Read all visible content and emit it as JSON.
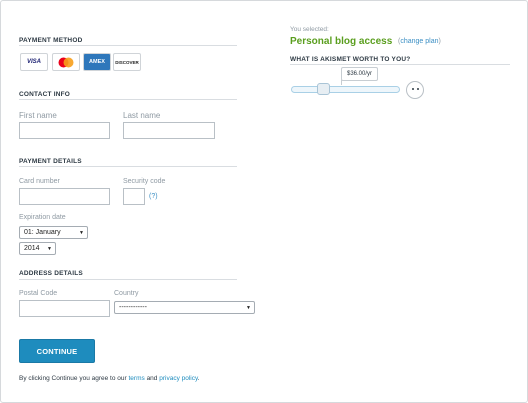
{
  "payment_method": {
    "title": "PAYMENT METHOD",
    "cards": [
      {
        "name": "visa-icon",
        "label": "VISA",
        "color": "#1a1f71"
      },
      {
        "name": "mastercard-icon",
        "label": "",
        "color": "#eb001b"
      },
      {
        "name": "amex-icon",
        "label": "AMEX",
        "color": "#2e77bb"
      },
      {
        "name": "discover-icon",
        "label": "DISCOVER",
        "color": "#222222"
      }
    ]
  },
  "contact_info": {
    "title": "CONTACT INFO",
    "first_name_placeholder": "First name",
    "last_name_placeholder": "Last name"
  },
  "payment_details": {
    "title": "PAYMENT DETAILS",
    "card_number_label": "Card number",
    "security_code_label": "Security code",
    "security_help": "(?)",
    "expiration_label": "Expiration date",
    "month_value": "01: January",
    "year_value": "2014"
  },
  "address_details": {
    "title": "ADDRESS DETAILS",
    "postal_code_label": "Postal Code",
    "country_label": "Country",
    "country_value": "------------"
  },
  "actions": {
    "continue_label": "CONTINUE",
    "terms_prefix": "By clicking Continue you agree to our",
    "terms_link": "terms",
    "and_text": "and",
    "privacy_link": "privacy policy",
    "period": "."
  },
  "plan": {
    "selected_label": "You selected:",
    "name": "Personal blog access",
    "change_open": "(",
    "change_link": "change plan",
    "change_close": ")",
    "worth_title": "WHAT IS AKISMET WORTH TO YOU?",
    "price": "$36.00/yr",
    "slider_fraction": 0.3
  },
  "colors": {
    "accent": "#1e8cbe",
    "plan_green": "#5a9e1e"
  }
}
